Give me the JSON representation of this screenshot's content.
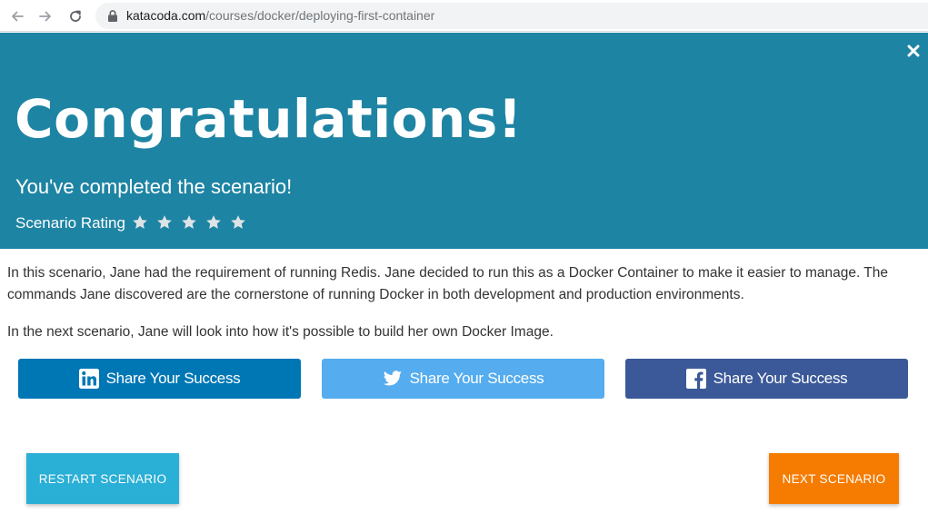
{
  "browser": {
    "url_host": "katacoda.com",
    "url_path": "/courses/docker/deploying-first-container"
  },
  "hero": {
    "title": "Congratulations!",
    "subtitle": "You've completed the scenario!",
    "rating_label": "Scenario Rating",
    "rating_max": 5,
    "background_color": "#1e84a3"
  },
  "body": {
    "paragraph_1": "In this scenario, Jane had the requirement of running Redis. Jane decided to run this as a Docker Container to make it easier to manage. The commands Jane discovered are the cornerstone of running Docker in both development and production environments.",
    "paragraph_2": "In the next scenario, Jane will look into how it's possible to build her own Docker Image."
  },
  "share": {
    "linkedin_label": "Share Your Success",
    "twitter_label": "Share Your Success",
    "facebook_label": "Share Your Success",
    "colors": {
      "linkedin": "#0077b5",
      "twitter": "#55acee",
      "facebook": "#3b5998"
    },
    "icons": {
      "linkedin": "linkedin-icon",
      "twitter": "twitter-icon",
      "facebook": "facebook-icon"
    }
  },
  "actions": {
    "restart_label": "RESTART SCENARIO",
    "next_label": "NEXT SCENARIO",
    "restart_color": "#2aafd6",
    "next_color": "#f57c00"
  }
}
